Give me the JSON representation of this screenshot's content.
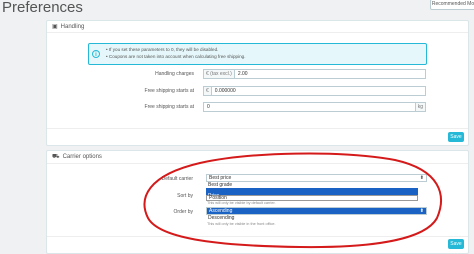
{
  "page": {
    "title": "Preferences",
    "recommended_label": "Recommended Mo"
  },
  "handling": {
    "title": "Handling",
    "info_lines": [
      "If you set these parameters to 0, they will be disabled.",
      "Coupons are not taken into account when calculating free shipping."
    ],
    "fields": [
      {
        "label": "Handling charges",
        "prefix": "€ (tax excl.)",
        "value": "2.00",
        "suffix": ""
      },
      {
        "label": "Free shipping starts at",
        "prefix": "€",
        "value": "0.000000",
        "suffix": ""
      },
      {
        "label": "Free shipping starts at",
        "prefix": "",
        "value": "0",
        "suffix": "kg"
      }
    ],
    "save_label": "Save"
  },
  "carrier": {
    "title": "Carrier options",
    "default_carrier": {
      "label": "Default carrier",
      "value": "Best price",
      "options": [
        "Best grade",
        "",
        "Price"
      ]
    },
    "sort_by": {
      "label": "Sort by",
      "value": "Position",
      "help": "This will only be visible by default carrier."
    },
    "order_by": {
      "label": "Order by",
      "value": "Ascending",
      "options": [
        "Descending"
      ],
      "help": "This will only be visible in the front office."
    },
    "save_label": "Save"
  },
  "colors": {
    "accent": "#25b9d7",
    "annotation": "#d41a1a",
    "selection": "#1a63c4"
  }
}
